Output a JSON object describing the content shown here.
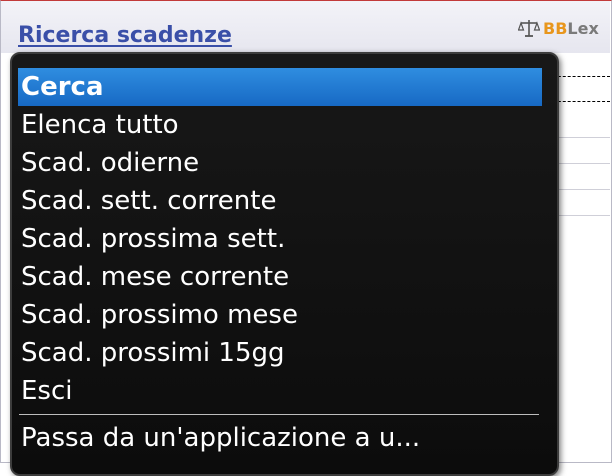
{
  "app": {
    "title": "Ricerca scadenze",
    "logo_text_b": "BB",
    "logo_text_lex": "Lex"
  },
  "menu": {
    "items": [
      {
        "label": "Cerca",
        "selected": true
      },
      {
        "label": "Elenca tutto"
      },
      {
        "label": "Scad. odierne"
      },
      {
        "label": "Scad. sett. corrente"
      },
      {
        "label": "Scad. prossima sett."
      },
      {
        "label": "Scad. mese corrente"
      },
      {
        "label": "Scad. prossimo mese"
      },
      {
        "label": "Scad. prossimi 15gg"
      },
      {
        "label": "Esci"
      }
    ],
    "extra": "Passa da un'applicazione a u..."
  },
  "colors": {
    "title": "#3a4fa8",
    "selection": "#1769c4",
    "menu_bg": "#111111",
    "logo_orange": "#e8961c"
  }
}
